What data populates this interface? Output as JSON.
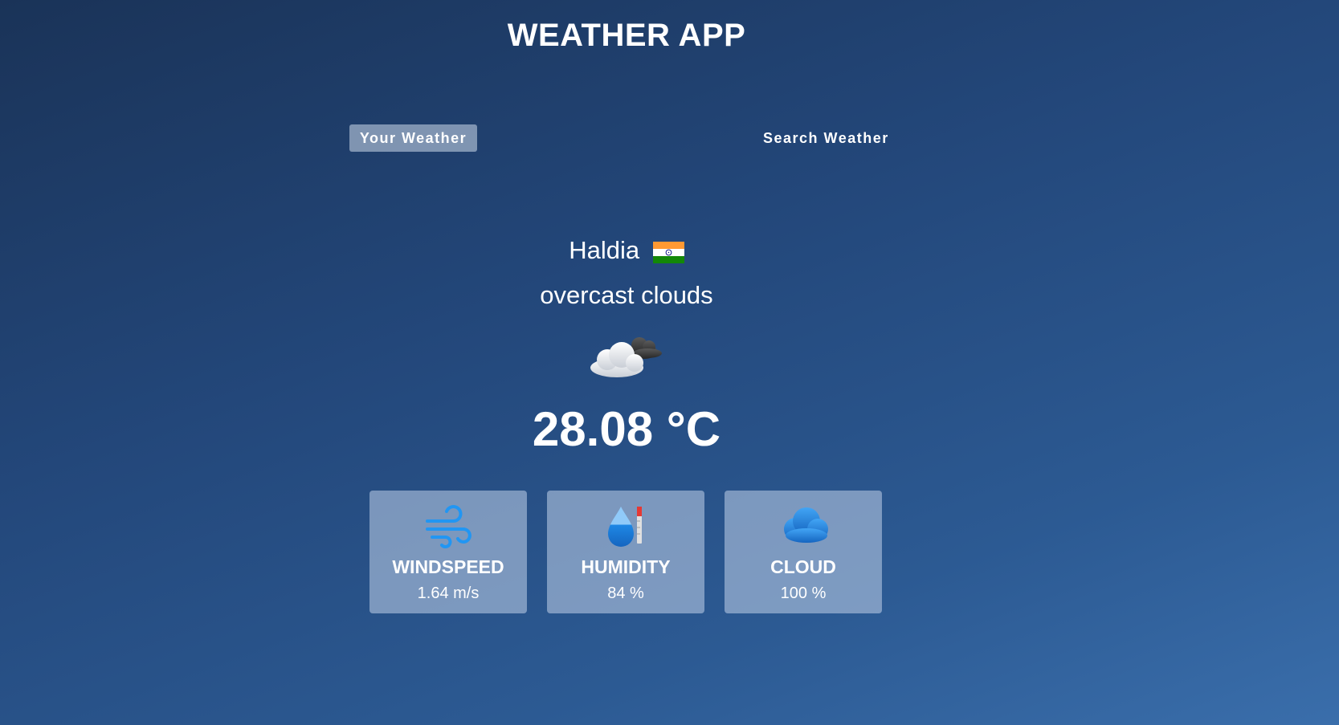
{
  "app": {
    "title": "WEATHER APP"
  },
  "tabs": [
    {
      "label": "Your Weather",
      "active": true
    },
    {
      "label": "Search Weather",
      "active": false
    }
  ],
  "location": {
    "city": "Haldia",
    "flag_icon": "india-flag-icon"
  },
  "weather": {
    "description": "overcast clouds",
    "icon": "overcast-clouds-icon",
    "temperature": "28.08 °C"
  },
  "stats": [
    {
      "label": "WINDSPEED",
      "value": "1.64 m/s",
      "icon": "wind-icon"
    },
    {
      "label": "HUMIDITY",
      "value": "84 %",
      "icon": "humidity-icon"
    },
    {
      "label": "CLOUD",
      "value": "100 %",
      "icon": "cloud-icon"
    }
  ],
  "colors": {
    "accent_blue": "#2196f3",
    "active_tab_bg": "#8fa5c4",
    "card_bg": "#8aa3c4"
  }
}
